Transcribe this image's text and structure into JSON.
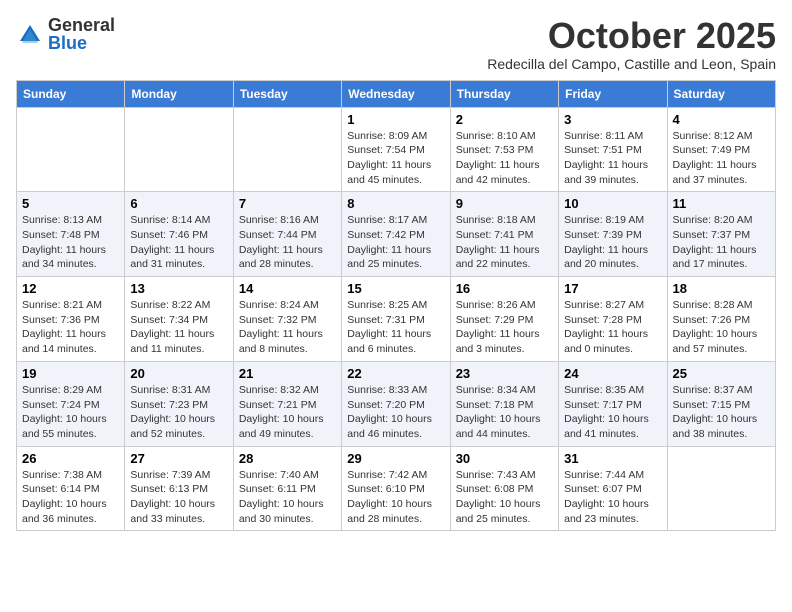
{
  "logo": {
    "general": "General",
    "blue": "Blue"
  },
  "header": {
    "month": "October 2025",
    "location": "Redecilla del Campo, Castille and Leon, Spain"
  },
  "weekdays": [
    "Sunday",
    "Monday",
    "Tuesday",
    "Wednesday",
    "Thursday",
    "Friday",
    "Saturday"
  ],
  "weeks": [
    [
      {
        "day": "",
        "info": ""
      },
      {
        "day": "",
        "info": ""
      },
      {
        "day": "",
        "info": ""
      },
      {
        "day": "1",
        "info": "Sunrise: 8:09 AM\nSunset: 7:54 PM\nDaylight: 11 hours and 45 minutes."
      },
      {
        "day": "2",
        "info": "Sunrise: 8:10 AM\nSunset: 7:53 PM\nDaylight: 11 hours and 42 minutes."
      },
      {
        "day": "3",
        "info": "Sunrise: 8:11 AM\nSunset: 7:51 PM\nDaylight: 11 hours and 39 minutes."
      },
      {
        "day": "4",
        "info": "Sunrise: 8:12 AM\nSunset: 7:49 PM\nDaylight: 11 hours and 37 minutes."
      }
    ],
    [
      {
        "day": "5",
        "info": "Sunrise: 8:13 AM\nSunset: 7:48 PM\nDaylight: 11 hours and 34 minutes."
      },
      {
        "day": "6",
        "info": "Sunrise: 8:14 AM\nSunset: 7:46 PM\nDaylight: 11 hours and 31 minutes."
      },
      {
        "day": "7",
        "info": "Sunrise: 8:16 AM\nSunset: 7:44 PM\nDaylight: 11 hours and 28 minutes."
      },
      {
        "day": "8",
        "info": "Sunrise: 8:17 AM\nSunset: 7:42 PM\nDaylight: 11 hours and 25 minutes."
      },
      {
        "day": "9",
        "info": "Sunrise: 8:18 AM\nSunset: 7:41 PM\nDaylight: 11 hours and 22 minutes."
      },
      {
        "day": "10",
        "info": "Sunrise: 8:19 AM\nSunset: 7:39 PM\nDaylight: 11 hours and 20 minutes."
      },
      {
        "day": "11",
        "info": "Sunrise: 8:20 AM\nSunset: 7:37 PM\nDaylight: 11 hours and 17 minutes."
      }
    ],
    [
      {
        "day": "12",
        "info": "Sunrise: 8:21 AM\nSunset: 7:36 PM\nDaylight: 11 hours and 14 minutes."
      },
      {
        "day": "13",
        "info": "Sunrise: 8:22 AM\nSunset: 7:34 PM\nDaylight: 11 hours and 11 minutes."
      },
      {
        "day": "14",
        "info": "Sunrise: 8:24 AM\nSunset: 7:32 PM\nDaylight: 11 hours and 8 minutes."
      },
      {
        "day": "15",
        "info": "Sunrise: 8:25 AM\nSunset: 7:31 PM\nDaylight: 11 hours and 6 minutes."
      },
      {
        "day": "16",
        "info": "Sunrise: 8:26 AM\nSunset: 7:29 PM\nDaylight: 11 hours and 3 minutes."
      },
      {
        "day": "17",
        "info": "Sunrise: 8:27 AM\nSunset: 7:28 PM\nDaylight: 11 hours and 0 minutes."
      },
      {
        "day": "18",
        "info": "Sunrise: 8:28 AM\nSunset: 7:26 PM\nDaylight: 10 hours and 57 minutes."
      }
    ],
    [
      {
        "day": "19",
        "info": "Sunrise: 8:29 AM\nSunset: 7:24 PM\nDaylight: 10 hours and 55 minutes."
      },
      {
        "day": "20",
        "info": "Sunrise: 8:31 AM\nSunset: 7:23 PM\nDaylight: 10 hours and 52 minutes."
      },
      {
        "day": "21",
        "info": "Sunrise: 8:32 AM\nSunset: 7:21 PM\nDaylight: 10 hours and 49 minutes."
      },
      {
        "day": "22",
        "info": "Sunrise: 8:33 AM\nSunset: 7:20 PM\nDaylight: 10 hours and 46 minutes."
      },
      {
        "day": "23",
        "info": "Sunrise: 8:34 AM\nSunset: 7:18 PM\nDaylight: 10 hours and 44 minutes."
      },
      {
        "day": "24",
        "info": "Sunrise: 8:35 AM\nSunset: 7:17 PM\nDaylight: 10 hours and 41 minutes."
      },
      {
        "day": "25",
        "info": "Sunrise: 8:37 AM\nSunset: 7:15 PM\nDaylight: 10 hours and 38 minutes."
      }
    ],
    [
      {
        "day": "26",
        "info": "Sunrise: 7:38 AM\nSunset: 6:14 PM\nDaylight: 10 hours and 36 minutes."
      },
      {
        "day": "27",
        "info": "Sunrise: 7:39 AM\nSunset: 6:13 PM\nDaylight: 10 hours and 33 minutes."
      },
      {
        "day": "28",
        "info": "Sunrise: 7:40 AM\nSunset: 6:11 PM\nDaylight: 10 hours and 30 minutes."
      },
      {
        "day": "29",
        "info": "Sunrise: 7:42 AM\nSunset: 6:10 PM\nDaylight: 10 hours and 28 minutes."
      },
      {
        "day": "30",
        "info": "Sunrise: 7:43 AM\nSunset: 6:08 PM\nDaylight: 10 hours and 25 minutes."
      },
      {
        "day": "31",
        "info": "Sunrise: 7:44 AM\nSunset: 6:07 PM\nDaylight: 10 hours and 23 minutes."
      },
      {
        "day": "",
        "info": ""
      }
    ]
  ]
}
